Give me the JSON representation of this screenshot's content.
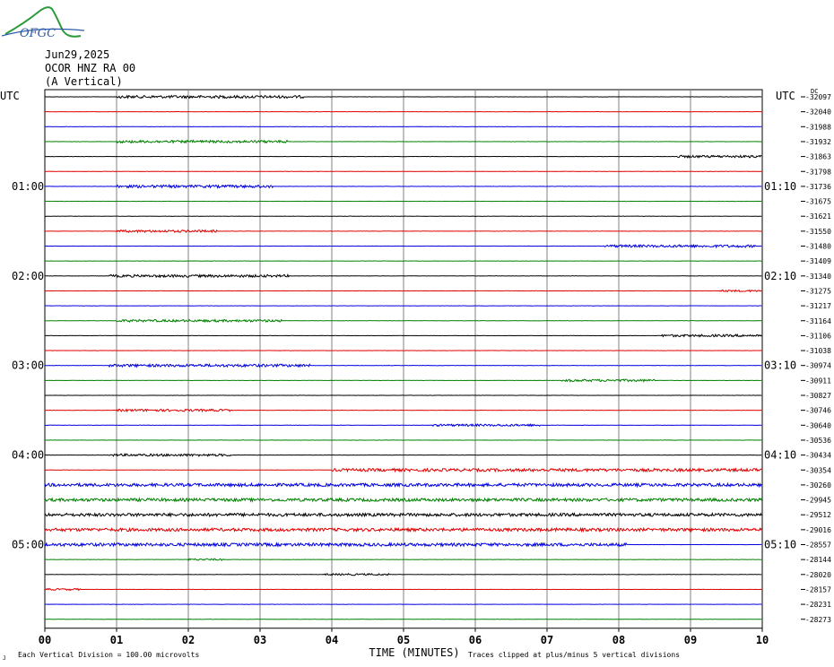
{
  "header": {
    "logo_text": "OFGC",
    "date": "Jun29,2025",
    "station": "OCOR HNZ RA 00",
    "component": "(A Vertical)",
    "left_utc": "UTC",
    "right_utc": "UTC"
  },
  "footer": {
    "scale_note": "Each Vertical Division =  100.00 microvolts",
    "clip_note": "Traces clipped at plus/minus 5 vertical divisions",
    "corner_mark": "J"
  },
  "colors": {
    "black": "#000000",
    "red": "#e00000",
    "blue": "#0000e0",
    "green": "#008000",
    "vgrid": "#808080"
  },
  "chart_data": {
    "type": "line",
    "title": "",
    "xlabel": "TIME (MINUTES)",
    "ylabel": "",
    "x_ticks": [
      "00",
      "01",
      "02",
      "03",
      "04",
      "05",
      "06",
      "07",
      "08",
      "09",
      "10"
    ],
    "xlim": [
      0,
      10
    ],
    "trace_colors": [
      "black",
      "red",
      "blue",
      "green"
    ],
    "left_labels": [
      {
        "row": 6,
        "text": "01:00"
      },
      {
        "row": 12,
        "text": "02:00"
      },
      {
        "row": 18,
        "text": "03:00"
      },
      {
        "row": 24,
        "text": "04:00"
      },
      {
        "row": 30,
        "text": "05:00"
      }
    ],
    "right_labels": [
      {
        "row": 6,
        "text": "01:10"
      },
      {
        "row": 12,
        "text": "02:10"
      },
      {
        "row": 18,
        "text": "03:10"
      },
      {
        "row": 24,
        "text": "04:10"
      },
      {
        "row": 30,
        "text": "05:10"
      }
    ],
    "top_right_marker": "DC",
    "offsets": [
      "-32097",
      "-32040",
      "-31988",
      "-31932",
      "-31863",
      "-31798",
      "-31736",
      "-31675",
      "-31621",
      "-31550",
      "-31480",
      "-31409",
      "-31340",
      "-31275",
      "-31217",
      "-31164",
      "-31106",
      "-31038",
      "-30974",
      "-30911",
      "-30827",
      "-30746",
      "-30640",
      "-30536",
      "-30434",
      "-30354",
      "-30260",
      "-29945",
      "-29512",
      "-29016",
      "-28557",
      "-28144",
      "-28020",
      "-28157",
      "-28231",
      "-28273"
    ],
    "activity": [
      {
        "row": 0,
        "start": 1.0,
        "end": 3.6,
        "amp": 1.5
      },
      {
        "row": 3,
        "start": 1.0,
        "end": 3.4,
        "amp": 1.4
      },
      {
        "row": 4,
        "start": 8.8,
        "end": 10.0,
        "amp": 1.3
      },
      {
        "row": 6,
        "start": 1.0,
        "end": 3.2,
        "amp": 1.5
      },
      {
        "row": 9,
        "start": 1.0,
        "end": 2.4,
        "amp": 1.3
      },
      {
        "row": 10,
        "start": 7.8,
        "end": 9.9,
        "amp": 1.4
      },
      {
        "row": 12,
        "start": 0.9,
        "end": 3.4,
        "amp": 1.4
      },
      {
        "row": 13,
        "start": 9.4,
        "end": 10.0,
        "amp": 1.0
      },
      {
        "row": 15,
        "start": 1.0,
        "end": 3.3,
        "amp": 1.3
      },
      {
        "row": 16,
        "start": 8.6,
        "end": 10.0,
        "amp": 1.3
      },
      {
        "row": 18,
        "start": 0.9,
        "end": 3.7,
        "amp": 1.5
      },
      {
        "row": 19,
        "start": 7.2,
        "end": 8.5,
        "amp": 1.3
      },
      {
        "row": 21,
        "start": 1.0,
        "end": 2.6,
        "amp": 1.3
      },
      {
        "row": 22,
        "start": 5.4,
        "end": 6.9,
        "amp": 1.2
      },
      {
        "row": 24,
        "start": 0.9,
        "end": 2.6,
        "amp": 1.3
      },
      {
        "row": 25,
        "start": 4.0,
        "end": 10.0,
        "amp": 1.6
      },
      {
        "row": 26,
        "start": 0.0,
        "end": 10.0,
        "amp": 1.7
      },
      {
        "row": 27,
        "start": 0.0,
        "end": 10.0,
        "amp": 1.7
      },
      {
        "row": 28,
        "start": 0.0,
        "end": 10.0,
        "amp": 1.7
      },
      {
        "row": 29,
        "start": 0.0,
        "end": 10.0,
        "amp": 1.7
      },
      {
        "row": 30,
        "start": 0.0,
        "end": 8.1,
        "amp": 1.7
      },
      {
        "row": 31,
        "start": 2.0,
        "end": 2.5,
        "amp": 1.0
      },
      {
        "row": 32,
        "start": 3.9,
        "end": 4.8,
        "amp": 1.0
      },
      {
        "row": 33,
        "start": 0.0,
        "end": 0.5,
        "amp": 1.0
      }
    ]
  }
}
